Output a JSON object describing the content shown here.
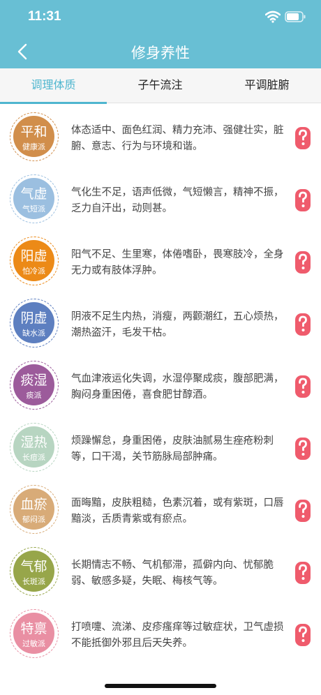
{
  "status": {
    "time": "11:31"
  },
  "header": {
    "title": "修身养性"
  },
  "tabs": [
    {
      "label": "调理体质"
    },
    {
      "label": "子午流注"
    },
    {
      "label": "平调脏腑"
    }
  ],
  "items": [
    {
      "name": "平和",
      "sub": "健康派",
      "color": "#d18e4b",
      "desc": "体态适中、面色红润、精力充沛、强健壮实，脏腑、意志、行为与环境和谐。"
    },
    {
      "name": "气虚",
      "sub": "气短派",
      "color": "#9bbfe0",
      "desc": "气化生不足，语声低微，气短懒言，精神不振，乏力自汗出，动则甚。"
    },
    {
      "name": "阳虚",
      "sub": "怕冷派",
      "color": "#ec8a17",
      "desc": "阳气不足、生里寒，体倦嗜卧，畏寒肢冷，全身无力或有肢体浮肿。"
    },
    {
      "name": "阴虚",
      "sub": "缺水派",
      "color": "#5d7fc0",
      "desc": "阴液不足生内热，消瘦，两颧潮红，五心烦热，潮热盗汗，毛发干枯。"
    },
    {
      "name": "痰湿",
      "sub": "痰派",
      "color": "#9c5b9b",
      "desc": "气血津液运化失调，水湿停聚成痰，腹部肥满，胸闷身重困倦，喜食肥甘醇酒。"
    },
    {
      "name": "湿热",
      "sub": "长痘派",
      "color": "#b7d5c1",
      "desc": "烦躁懈怠，身重困倦，皮肤油腻易生痤疮粉刺等，口干渴，关节筋脉局部肿痛。"
    },
    {
      "name": "血瘀",
      "sub": "郁闷派",
      "color": "#d8ab78",
      "desc": "面晦黯，皮肤粗糙，色素沉着，或有紫斑，口唇黯淡，舌质青紫或有瘀点。"
    },
    {
      "name": "气郁",
      "sub": "长斑派",
      "color": "#97a64a",
      "desc": "长期情志不畅、气机郁滞，孤僻内向、忧郁脆弱、敏感多疑，失眠、梅核气等。"
    },
    {
      "name": "特禀",
      "sub": "过敏派",
      "color": "#e98fa3",
      "desc": "打喷嚏、流涕、皮疹瘙痒等过敏症状，卫气虚损不能抵御外邪且后天失养。"
    }
  ]
}
